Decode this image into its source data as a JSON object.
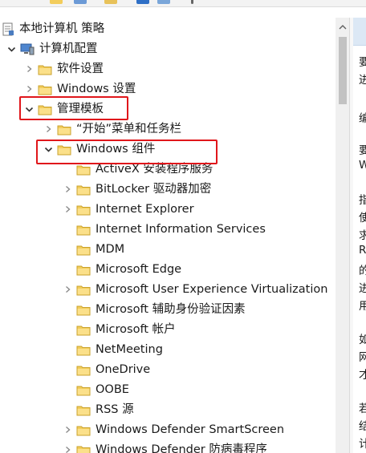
{
  "tree": [
    {
      "label": "本地计算机 策略",
      "icon": "policy-doc-icon",
      "depth": 0,
      "expander": "none",
      "name": "tree-item-local-computer-policy"
    },
    {
      "label": "计算机配置",
      "icon": "computer-icon",
      "depth": 0,
      "expander": "expanded",
      "name": "tree-item-computer-configuration"
    },
    {
      "label": "软件设置",
      "icon": "folder-icon",
      "depth": 1,
      "expander": "collapsed",
      "name": "tree-item-software-settings"
    },
    {
      "label": "Windows 设置",
      "icon": "folder-icon",
      "depth": 1,
      "expander": "collapsed",
      "name": "tree-item-windows-settings"
    },
    {
      "label": "管理模板",
      "icon": "folder-icon",
      "depth": 1,
      "expander": "expanded",
      "name": "tree-item-administrative-templates"
    },
    {
      "label": "“开始”菜单和任务栏",
      "icon": "folder-icon",
      "depth": 2,
      "expander": "collapsed",
      "name": "tree-item-start-menu-taskbar"
    },
    {
      "label": "Windows 组件",
      "icon": "folder-icon",
      "depth": 2,
      "expander": "expanded",
      "name": "tree-item-windows-components"
    },
    {
      "label": "ActiveX 安装程序服务",
      "icon": "folder-icon",
      "depth": 3,
      "expander": "none",
      "name": "tree-item-activex-installer"
    },
    {
      "label": "BitLocker 驱动器加密",
      "icon": "folder-icon",
      "depth": 3,
      "expander": "collapsed",
      "name": "tree-item-bitlocker"
    },
    {
      "label": "Internet Explorer",
      "icon": "folder-icon",
      "depth": 3,
      "expander": "collapsed",
      "name": "tree-item-internet-explorer"
    },
    {
      "label": "Internet Information Services",
      "icon": "folder-icon",
      "depth": 3,
      "expander": "none",
      "name": "tree-item-iis"
    },
    {
      "label": "MDM",
      "icon": "folder-icon",
      "depth": 3,
      "expander": "none",
      "name": "tree-item-mdm"
    },
    {
      "label": "Microsoft Edge",
      "icon": "folder-icon",
      "depth": 3,
      "expander": "none",
      "name": "tree-item-microsoft-edge"
    },
    {
      "label": "Microsoft User Experience Virtualization",
      "icon": "folder-icon",
      "depth": 3,
      "expander": "collapsed",
      "name": "tree-item-ue-v"
    },
    {
      "label": "Microsoft 辅助身份验证因素",
      "icon": "folder-icon",
      "depth": 3,
      "expander": "none",
      "name": "tree-item-secondary-auth"
    },
    {
      "label": "Microsoft 帐户",
      "icon": "folder-icon",
      "depth": 3,
      "expander": "none",
      "name": "tree-item-microsoft-account"
    },
    {
      "label": "NetMeeting",
      "icon": "folder-icon",
      "depth": 3,
      "expander": "none",
      "name": "tree-item-netmeeting"
    },
    {
      "label": "OneDrive",
      "icon": "folder-icon",
      "depth": 3,
      "expander": "none",
      "name": "tree-item-onedrive"
    },
    {
      "label": "OOBE",
      "icon": "folder-icon",
      "depth": 3,
      "expander": "none",
      "name": "tree-item-oobe"
    },
    {
      "label": "RSS 源",
      "icon": "folder-icon",
      "depth": 3,
      "expander": "none",
      "name": "tree-item-rss"
    },
    {
      "label": "Windows Defender SmartScreen",
      "icon": "folder-icon",
      "depth": 3,
      "expander": "collapsed",
      "name": "tree-item-smartscreen"
    },
    {
      "label": "Windows Defender 防病毒程序",
      "icon": "folder-icon",
      "depth": 3,
      "expander": "collapsed",
      "name": "tree-item-defender-antivirus"
    }
  ],
  "right_pane_fragments": [
    "要",
    "进",
    "编",
    "要",
    "W",
    "指",
    "使",
    "求",
    "R",
    "的",
    "进",
    "用",
    "如",
    "网",
    "才",
    "若",
    "结",
    "计"
  ],
  "colors": {
    "highlight": "#e0161b",
    "folder_fill": "#f3cd5c",
    "folder_edge": "#c9a22c",
    "header_bg": "#dce8f5"
  }
}
